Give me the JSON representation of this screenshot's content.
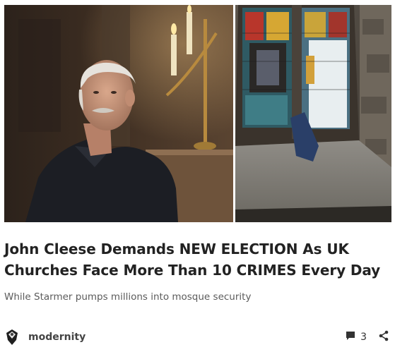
{
  "post": {
    "title": "John Cleese Demands NEW ELECTION As UK Churches Face More Than 10 CRIMES Every Day",
    "subtitle": "While Starmer pumps millions into mosque security",
    "author": "modernity",
    "comment_count": "3"
  },
  "images": {
    "left": "man-in-dark-jacket-with-candles-photo",
    "right": "stained-glass-church-window-photo"
  },
  "icons": {
    "avatar": "shield-avatar-icon",
    "comment": "comment-bubble-icon",
    "share": "share-icon"
  },
  "colors": {
    "title": "#222222",
    "subtitle": "#5b5b5b",
    "meta": "#444444"
  }
}
